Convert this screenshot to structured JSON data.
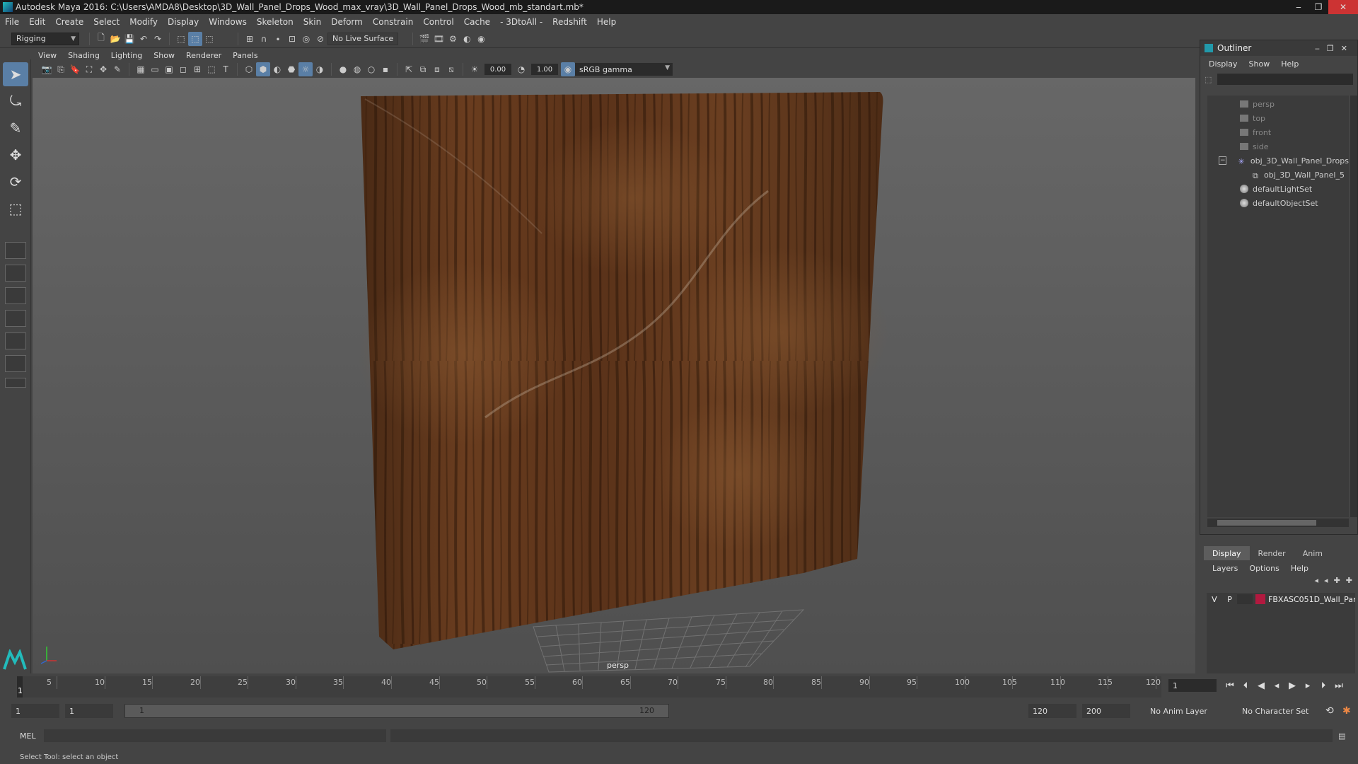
{
  "window": {
    "title": "Autodesk Maya 2016: C:\\Users\\AMDA8\\Desktop\\3D_Wall_Panel_Drops_Wood_max_vray\\3D_Wall_Panel_Drops_Wood_mb_standart.mb*"
  },
  "menubar": [
    "File",
    "Edit",
    "Create",
    "Select",
    "Modify",
    "Display",
    "Windows",
    "Skeleton",
    "Skin",
    "Deform",
    "Constrain",
    "Control",
    "Cache",
    "- 3DtoAll -",
    "Redshift",
    "Help"
  ],
  "shelf": {
    "mode": "Rigging",
    "live_surface": "No Live Surface"
  },
  "viewport": {
    "menu": [
      "View",
      "Shading",
      "Lighting",
      "Show",
      "Renderer",
      "Panels"
    ],
    "exposure": "0.00",
    "gamma_value": "1.00",
    "color_space": "sRGB gamma",
    "camera": "persp"
  },
  "outliner": {
    "title": "Outliner",
    "menu": [
      "Display",
      "Show",
      "Help"
    ],
    "items": [
      {
        "label": "persp",
        "type": "camera"
      },
      {
        "label": "top",
        "type": "camera"
      },
      {
        "label": "front",
        "type": "camera"
      },
      {
        "label": "side",
        "type": "camera"
      },
      {
        "label": "obj_3D_Wall_Panel_Drops",
        "type": "group"
      },
      {
        "label": "obj_3D_Wall_Panel_5",
        "type": "mesh"
      },
      {
        "label": "defaultLightSet",
        "type": "set"
      },
      {
        "label": "defaultObjectSet",
        "type": "set"
      }
    ]
  },
  "layers": {
    "tabs": [
      "Display",
      "Render",
      "Anim"
    ],
    "menu": [
      "Layers",
      "Options",
      "Help"
    ],
    "rows": [
      {
        "v": "V",
        "p": "P",
        "name": "FBXASC051D_Wall_Par",
        "color": "#b2193f"
      }
    ]
  },
  "timeline": {
    "ticks": [
      "5",
      "10",
      "15",
      "20",
      "25",
      "30",
      "35",
      "40",
      "45",
      "50",
      "55",
      "60",
      "65",
      "70",
      "75",
      "80",
      "85",
      "90",
      "95",
      "100",
      "105",
      "110",
      "115",
      "120"
    ],
    "first": "1",
    "current_frame": "1"
  },
  "range": {
    "start": "1",
    "anim_start": "1",
    "slider_start": "1",
    "slider_end": "120",
    "anim_end": "120",
    "end": "200",
    "anim_layer": "No Anim Layer",
    "character_set": "No Character Set"
  },
  "cmdline": {
    "lang": "MEL"
  },
  "status": "Select Tool: select an object"
}
